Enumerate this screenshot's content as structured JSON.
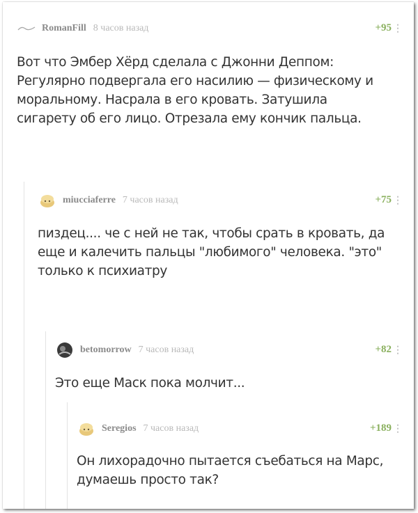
{
  "colors": {
    "username": "#8b8b8b",
    "time": "#b9b9b9",
    "rating": "#8ab05e",
    "text": "#333333",
    "thread_line": "#e2e2e2"
  },
  "comments": [
    {
      "username": "RomanFill",
      "time": "8 часов назад",
      "rating": "+95",
      "avatar_icon": "default-wave-icon",
      "text": "Вот что Эмбер Хёрд сделала с Джонни Деппом: Регулярно подвергала его насилию — физическому и моральному. Насрала в его кровать. Затушила сигарету об его лицо. Отрезала ему кончик пальца."
    },
    {
      "username": "miucciaferre",
      "time": "7 часов назад",
      "rating": "+75",
      "avatar_icon": "bread-avatar-icon",
      "text": "пиздец.... че с ней не так, чтобы срать в кровать, да еще и калечить пальцы \"любимого\" человека. \"это\" только к психиатру"
    },
    {
      "username": "betomorrow",
      "time": "7 часов назад",
      "rating": "+82",
      "avatar_icon": "photo-avatar-icon",
      "text": "Это еще Маск пока молчит..."
    },
    {
      "username": "Seregios",
      "time": "7 часов назад",
      "rating": "+189",
      "avatar_icon": "bread-avatar-icon",
      "text": "Он лихорадочно пытается съебаться на Марс, думаешь просто так?"
    }
  ],
  "more_glyph": "⋮"
}
